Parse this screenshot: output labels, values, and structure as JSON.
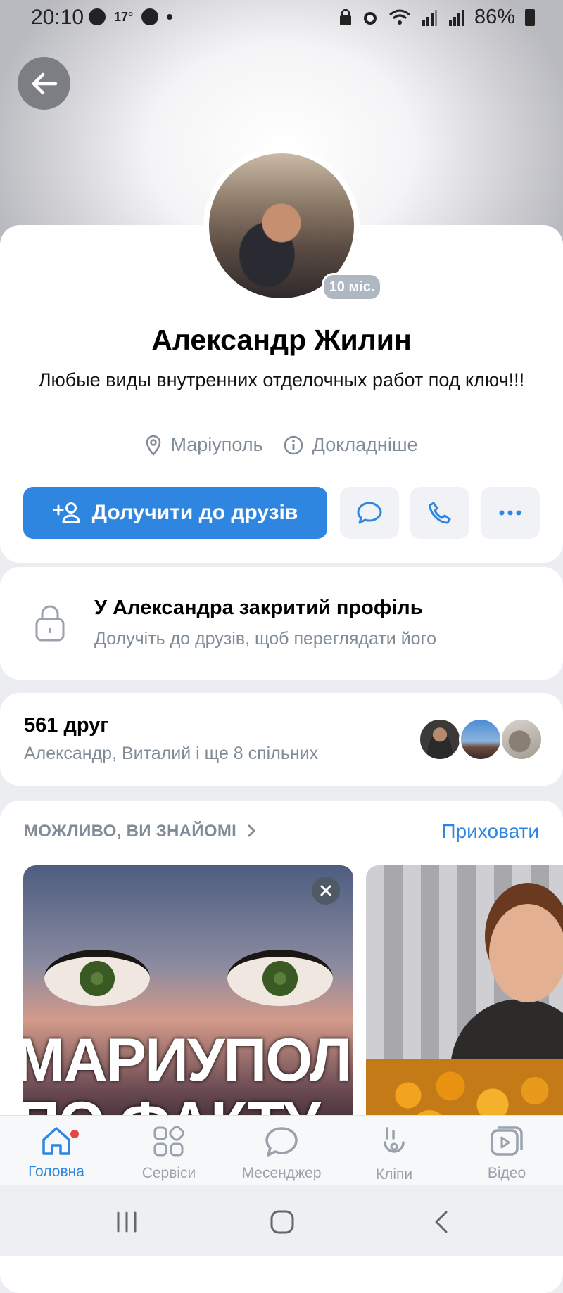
{
  "status_bar": {
    "time": "20:10",
    "temperature": "17°",
    "battery": "86%"
  },
  "profile": {
    "avatar_badge": "10 міс.",
    "name": "Александр Жилин",
    "status_text": "Любые виды внутренних отделочных работ под ключ!!!",
    "city": "Маріуполь",
    "details_link": "Докладніше",
    "add_friend_label": "Долучити до друзів"
  },
  "closed_profile": {
    "title": "У Александра закритий профіль",
    "subtitle": "Долучіть до друзів, щоб переглядати його"
  },
  "friends": {
    "count_label": "561 друг",
    "mutual_label": "Александр, Виталий і ще 8 спільних"
  },
  "suggestions": {
    "title": "МОЖЛИВО, ВИ ЗНАЙОМІ",
    "hide_label": "Приховати",
    "card1_text_line1": "МАРИУПОЛ",
    "card1_text_line2": "ПО ФАКТУ"
  },
  "tabbar": {
    "tabs": [
      {
        "label": "Головна",
        "icon": "home-icon",
        "active": true
      },
      {
        "label": "Сервіси",
        "icon": "services-icon"
      },
      {
        "label": "Месенджер",
        "icon": "messenger-icon"
      },
      {
        "label": "Кліпи",
        "icon": "clips-icon"
      },
      {
        "label": "Відео",
        "icon": "video-icon"
      }
    ]
  },
  "colors": {
    "accent": "#2f86e0",
    "secondary_text": "#818c99",
    "notification": "#e64646"
  }
}
